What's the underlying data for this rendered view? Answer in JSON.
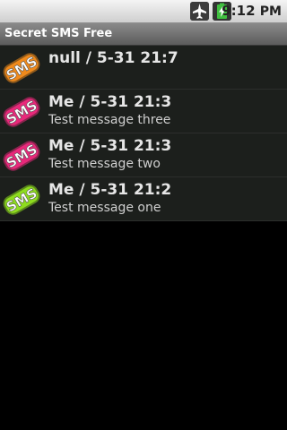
{
  "status_bar": {
    "time": "9:12",
    "time_suffix": "PM",
    "icons": [
      "airplane-mode-icon",
      "battery-charging-icon"
    ]
  },
  "app": {
    "title": "Secret SMS Free"
  },
  "messages": [
    {
      "title": "null / 5-31 21:7",
      "body": "",
      "icon_text": "SMS",
      "icon_color": "#f08a1c"
    },
    {
      "title": "Me / 5-31 21:3",
      "body": "Test message three",
      "icon_text": "SMS",
      "icon_color": "#e8287a"
    },
    {
      "title": "Me / 5-31 21:3",
      "body": "Test message two",
      "icon_text": "SMS",
      "icon_color": "#e8287a"
    },
    {
      "title": "Me / 5-31 21:2",
      "body": "Test message one",
      "icon_text": "SMS",
      "icon_color": "#8edc1e"
    }
  ]
}
